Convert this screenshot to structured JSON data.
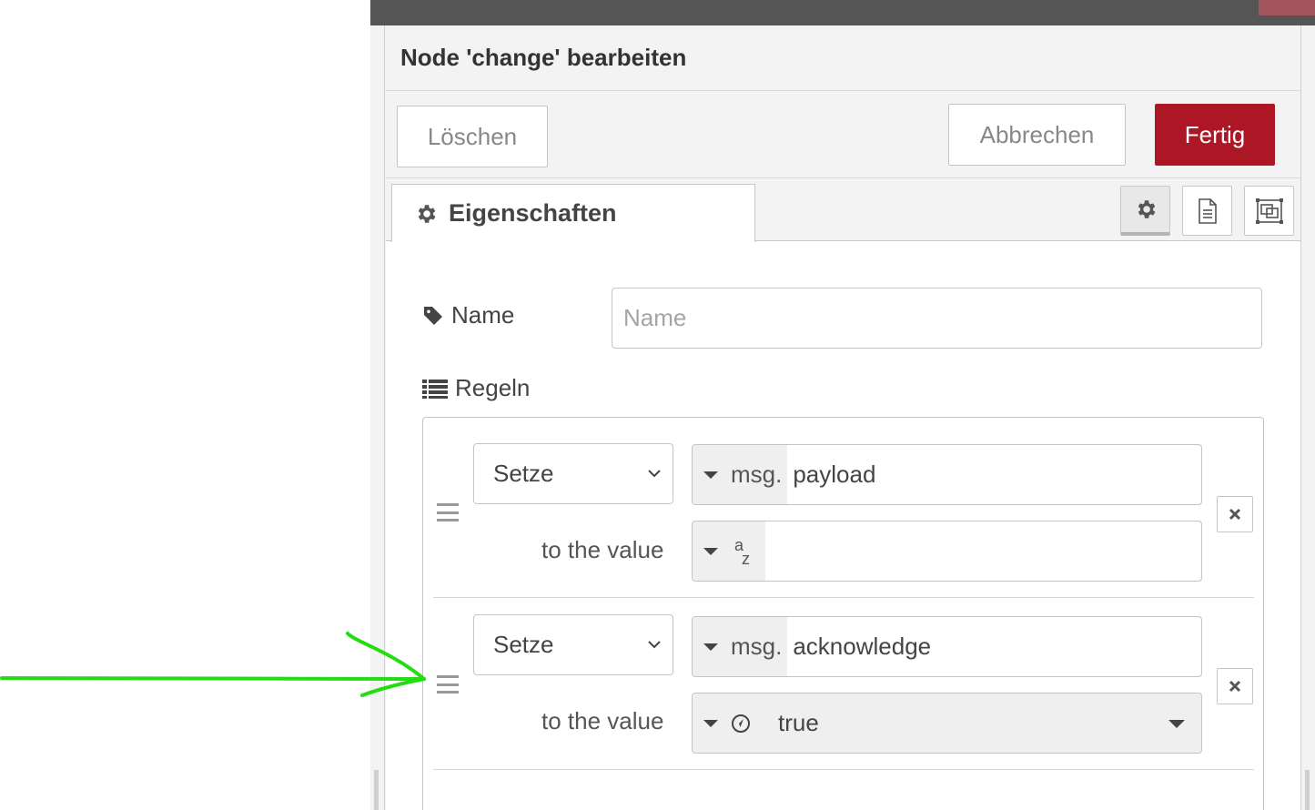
{
  "tray": {
    "title": "Node 'change' bearbeiten",
    "buttons": {
      "delete": "Löschen",
      "cancel": "Abbrechen",
      "done": "Fertig"
    },
    "tabs": {
      "active_label": "Eigenschaften",
      "icons": [
        "gear-icon",
        "document-icon",
        "frame-icon"
      ]
    }
  },
  "form": {
    "name_label": "Name",
    "name_placeholder": "Name",
    "name_value": "",
    "rules_label": "Regeln"
  },
  "rules": [
    {
      "action": "Setze",
      "target_prefix": "msg.",
      "target_value": "payload",
      "value_label": "to the value",
      "value_type_icon": "string-az-icon",
      "value": ""
    },
    {
      "action": "Setze",
      "target_prefix": "msg.",
      "target_value": "acknowledge",
      "value_label": "to the value",
      "value_type_icon": "boolean-icon",
      "value": "true"
    }
  ],
  "colors": {
    "accent_red": "#ad1625",
    "annotation_arrow": "#22dd11",
    "topbar": "#555555"
  }
}
